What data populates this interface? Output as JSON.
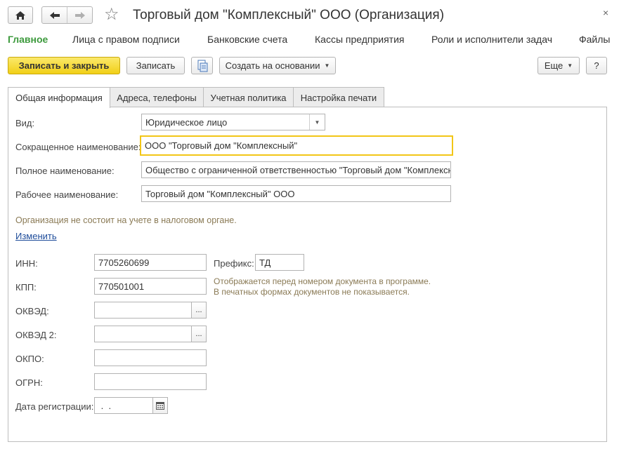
{
  "window": {
    "title": "Торговый дом \"Комплексный\" ООО (Организация)",
    "close_glyph": "×",
    "star_glyph": "☆"
  },
  "sections": [
    "Главное",
    "Лица с правом подписи",
    "Банковские счета",
    "Кассы предприятия",
    "Роли и исполнители задач",
    "Файлы"
  ],
  "toolbar": {
    "save_close_label": "Записать и закрыть",
    "save_label": "Записать",
    "create_based_label": "Создать на основании",
    "more_label": "Еще",
    "help_label": "?"
  },
  "form_tabs": [
    "Общая информация",
    "Адреса, телефоны",
    "Учетная политика",
    "Настройка печати"
  ],
  "form": {
    "kind_label": "Вид:",
    "kind_value": "Юридическое лицо",
    "short_name_label": "Сокращенное наименование:",
    "short_name_value": "ООО \"Торговый дом \"Комплексный\"",
    "full_name_label": "Полное наименование:",
    "full_name_value": "Общество с ограниченной ответственностью \"Торговый дом \"Комплексный\"",
    "work_name_label": "Рабочее наименование:",
    "work_name_value": "Торговый дом \"Комплексный\" ООО",
    "tax_note": "Организация не состоит на учете в налоговом органе.",
    "change_link": "Изменить",
    "inn_label": "ИНН:",
    "inn_value": "7705260699",
    "prefix_label": "Префикс:",
    "prefix_value": "ТД",
    "kpp_label": "КПП:",
    "kpp_value": "770501001",
    "prefix_note_1": "Отображается перед номером документа в программе.",
    "prefix_note_2": "В печатных формах документов не показывается.",
    "okved_label": "ОКВЭД:",
    "okved_value": "",
    "okved2_label": "ОКВЭД 2:",
    "okved2_value": "",
    "okpo_label": "ОКПО:",
    "okpo_value": "",
    "ogrn_label": "ОГРН:",
    "ogrn_value": "",
    "reg_date_label": "Дата регистрации:",
    "reg_date_value": " .  .",
    "select_glyph": "..."
  },
  "colors": {
    "primary_button": "#f1cf17",
    "active_section": "#3d9a3d",
    "focus_border": "#f2c617",
    "note_text": "#8a7a55",
    "link": "#1e4c9a"
  }
}
